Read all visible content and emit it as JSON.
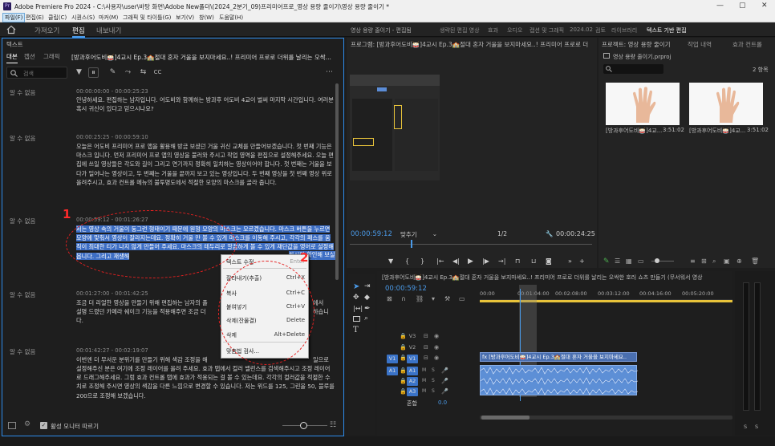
{
  "titlebar": {
    "icon": "Pr",
    "title": "Adobe Premiere Pro 2024 - C:\\사용자\\user\\바탕 화면\\Adobe New폴더\\(2024_2분기_09)프리미어프로_영상 용량 줄이기\\영상 용량 줄이기 *",
    "controls": [
      "—",
      "▢",
      "✕"
    ]
  },
  "menubar": {
    "items": [
      "파일(F)",
      "편집(E)",
      "클립(C)",
      "시퀀스(S)",
      "마커(M)",
      "그래픽 및 타이틀(G)",
      "보기(V)",
      "창(W)",
      "도움말(H)"
    ]
  },
  "workspace": {
    "tabs": [
      "가져오기",
      "편집",
      "내보내기"
    ],
    "active": "편집",
    "center_title": "영상 용량 줄이기 - 편집됨",
    "right_tabs": [
      "생략된 편집 영상",
      "효과",
      "오디오",
      "캡션 및 그래픽",
      "2024.02",
      "검토",
      "라이브러리",
      "텍스트 기반 편집"
    ]
  },
  "text_panel": {
    "title": "텍스트",
    "tabs": [
      "대본",
      "캡션",
      "그래픽"
    ],
    "active_tab": "대본",
    "sequence_name": "[방과후어도비🥁]4교시 Ep.3🏫절대 혼자 거울을 보지마세요..! 프리미어 프로로 더위를 날리는 오싹...",
    "search_placeholder": "검색",
    "segments": [
      {
        "speaker": "알 수 없음",
        "timecode": "00:00:00:00 - 00:00:25:23",
        "text": "안녕하세요. 편집하는 남자입니다. 어도비와 함께하는 방과후 어도비 4교이 벌써 마지막 시간입니다. 여러분 혹시 귀신이 있다고 믿으시나요?"
      },
      {
        "speaker": "알 수 없음",
        "timecode": "00:00:25:25 - 00:00:59:10",
        "text": "오늘은 어도비 프리미어 프로 앱을 활용해 방금 보셨던 거울 귀신 교체를 만들어보겠습니다. 첫 번째 기능은 마스크 입니다. 먼저 프리미어 프로 앱의 영상을 불러와 주시고 작업 영역을 편집으로 설정해주세요. 오늘 편집에 쓰일 영상들은 각도와 길이 그리고 연기까지 정확히 일치하는 영상이어야 합니다. 첫 번째는 거울을 보다가 일어나는 영상이고, 두 번째는 거울을 끝까지 보고 있는 영상입니다. 두 번째 영상을 첫 번째 영상 위로 올려주시고, 효과 컨트롤 메뉴의 불투명도에서 적절한 모양의 마스크를 골라 줍니다."
      },
      {
        "speaker": "알 수 없음",
        "timecode": "00:00:59:12 - 00:01:26:27",
        "text": "저는 영상 속의 거울이 둥그런 형태이기 때문에 원형 모양의 마스크는 모르겠습니다. 마스크 버튼을 누르면 모양에 맞춰서 영상이 잘라지는데요. 정확히 거울 만 볼 수 있게 마스크를 이동해 주시고, 각각의 패스를 움직이 최대한 티가 나지 않게 만들어 주세요. 마스크의 테두리로 깔끔하게 볼 수 있게 재단값을 영어로 설정해봅니다. 그리고 재생해",
        "tail": "하시면 확인해 보실 수 있습니다."
      },
      {
        "speaker": "알 수 없음",
        "timecode": "00:01:27:00 - 00:01:42:25",
        "text": "조금 더 리얼한 영상을 만들기 위해 편집하는 남자의 플",
        "text2": "설명 드렸던 카메라 쉐이크 기능을 적용해주면 조금 더",
        "tail1": "에서",
        "tail2": "하습니",
        "text3": "다."
      },
      {
        "speaker": "알 수 없음",
        "timecode": "00:01:42:27 - 00:02:19:07",
        "text": "이번엔 더 무서운 분위기를 만들기 위해 색감 조정을 해",
        "tail": "일으로",
        "text2": "설정해주신 분은 여기에 조정 레이어를 올려 주세요. 효과 탭에서 컬러 밸런스를 검색해주시고 조정 레이어로 드래그해주세요. 그럼 효과 컨트롤 탭에 효과가 적용되는 걸 볼 수 있는데요. 각각의 컬러값을 적절한 수치로 조정해 주시면 영상의 색감을 다른 느낌으로 변경할 수 있습니다. 저는 위드를 125, 그린을 50, 블루를 200으로 조정해 보겠습니다."
      }
    ],
    "footer_label": "활성 모니터 따르기",
    "context_menu": [
      {
        "label": "텍스트 수정",
        "shortcut": "Enter"
      },
      {
        "label": "잘라내기(추출)",
        "shortcut": "Ctrl+X"
      },
      {
        "label": "복사",
        "shortcut": "Ctrl+C"
      },
      {
        "label": "붙여넣기",
        "shortcut": "Ctrl+V"
      },
      {
        "label": "삭제(잔물결)",
        "shortcut": "Delete"
      },
      {
        "label": "삭제",
        "shortcut": "Alt+Delete"
      },
      {
        "label": "맞춤법 검사...",
        "shortcut": ""
      }
    ],
    "annotations": [
      "1",
      "2"
    ]
  },
  "program_monitor": {
    "title": "프로그램: [방과후어도비🥁]4교시 Ep.3🏫절대 혼자 거울을 보지마세요..! 프리미어 프로로 더",
    "timecode": "00:00:59:12",
    "fit": "맞추기",
    "resolution": "1/2",
    "duration": "00:00:24:25"
  },
  "project_panel": {
    "title": "프로젝트: 영상 용량 줄이기",
    "tab2": "작업 내역",
    "tab3": "효과 컨트롤",
    "file": "영상 용량 줄이기.prproj",
    "count": "2 항목",
    "items": [
      {
        "name": "[방과후어도비🥁]4교...",
        "duration": "3:51:02"
      },
      {
        "name": "[방과후어도비🥁]4교...",
        "duration": "3:51:02"
      }
    ]
  },
  "timeline": {
    "title": "[방과후어도비🥁]4교시 Ep.3🏫절대 혼자 거울을 보지마세요..! 프리미어 프로로 더위를 날리는 오싹한 호러 쇼츠 만들기 (무서워서 영상",
    "timecode": "00:00:59:12",
    "ruler": [
      "00:00",
      "00:01:04:00",
      "00:02:08:00",
      "00:03:12:00",
      "00:04:16:00",
      "00:05:20:00"
    ],
    "video_tracks": [
      "V3",
      "V2",
      "V1"
    ],
    "audio_tracks": [
      "A1",
      "A2",
      "A3"
    ],
    "v1_target": "V1",
    "a1_target": "A1",
    "mix_label": "혼합",
    "mix_value": "0.0",
    "clip_label": "fx [방과후어도비🥁]4교시 Ep.3🏫절대 혼자 거울을 보지마세요..",
    "meter_labels": [
      "S",
      "S"
    ]
  },
  "colors": {
    "accent": "#2d8ceb",
    "playhead": "#4a9ae8",
    "highlight": "#3d6ec4",
    "annotation": "#e62020",
    "video_clip": "#4a6fb0",
    "audio_clip": "#5d8fd6",
    "target_track": "#3a73c8"
  }
}
